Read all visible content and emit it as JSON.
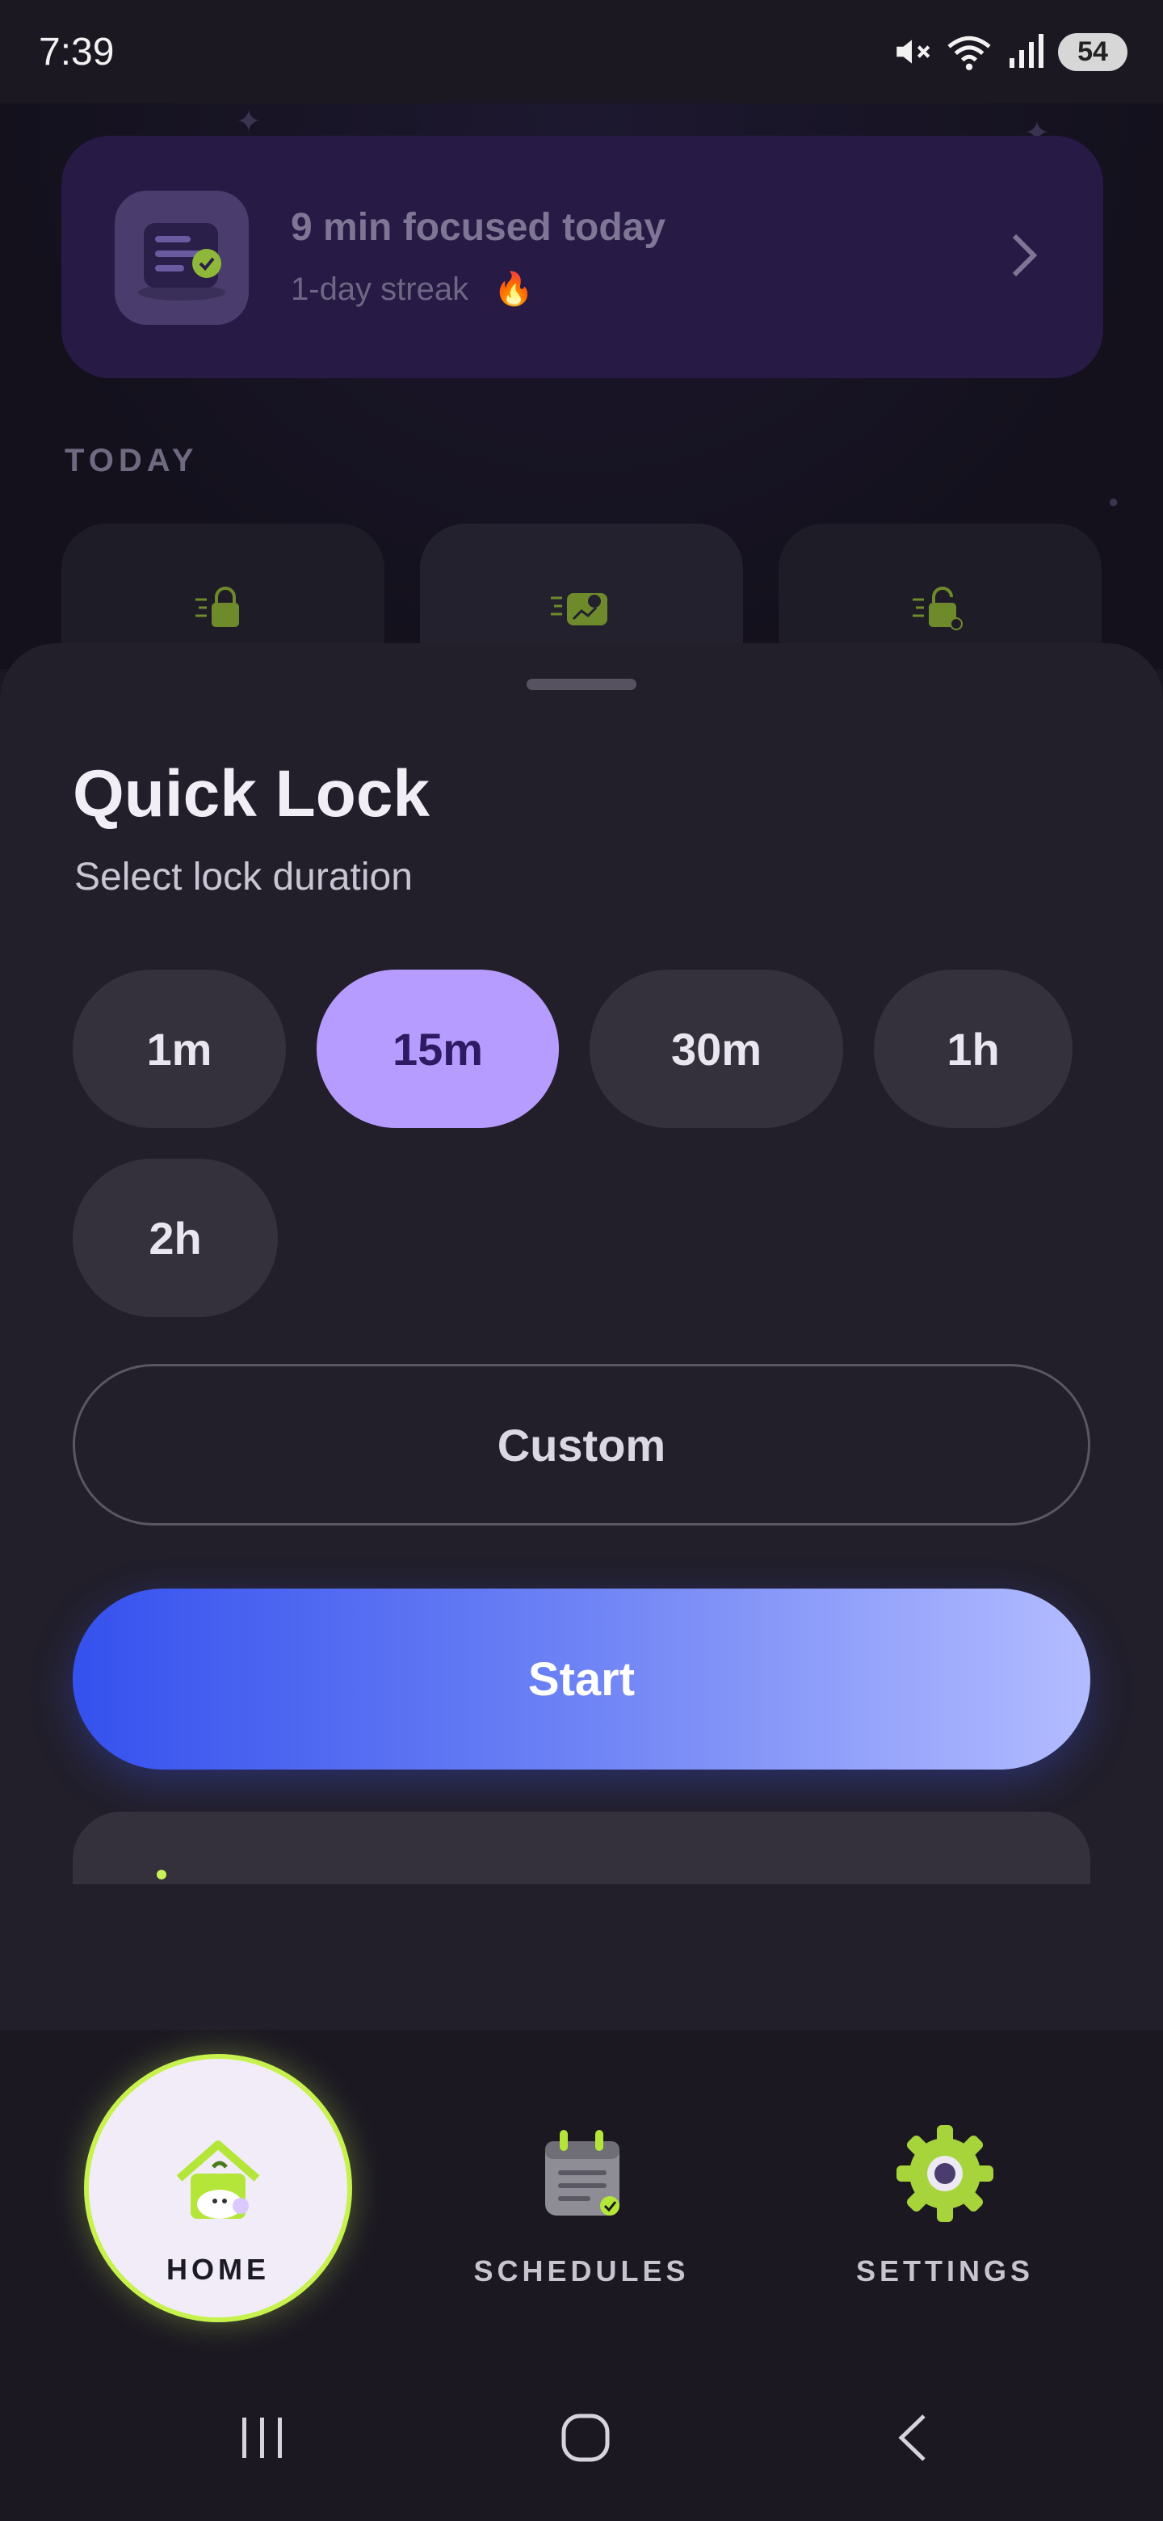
{
  "status_bar": {
    "time": "7:39",
    "battery": "54"
  },
  "focus_card": {
    "title": "9 min focused today",
    "streak": "1-day streak",
    "streak_emoji": "🔥"
  },
  "today": {
    "label": "TODAY"
  },
  "quick_lock": {
    "title": "Quick Lock",
    "subtitle": "Select lock duration",
    "durations": [
      "1m",
      "15m",
      "30m",
      "1h",
      "2h"
    ],
    "selected_duration": "15m",
    "custom_label": "Custom",
    "start_label": "Start"
  },
  "bottom_nav": {
    "items": [
      {
        "label": "HOME",
        "icon": "house-icon",
        "active": true
      },
      {
        "label": "SCHEDULES",
        "icon": "calendar-icon",
        "active": false
      },
      {
        "label": "SETTINGS",
        "icon": "gear-icon",
        "active": false
      }
    ]
  },
  "colors": {
    "accent_lime": "#c7f24e",
    "selected_chip": "#b69cff",
    "start_gradient_start": "#3551ee",
    "start_gradient_end": "#b3bcff"
  }
}
